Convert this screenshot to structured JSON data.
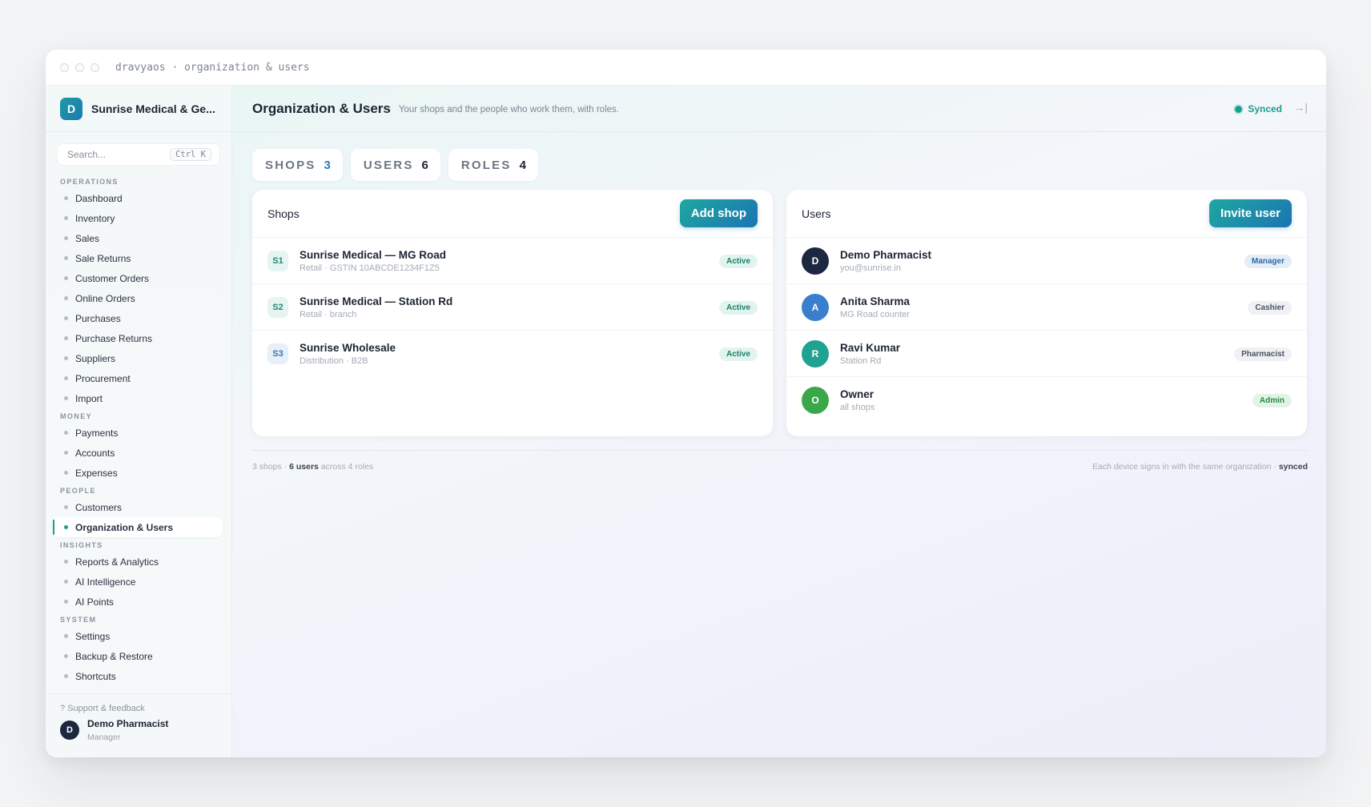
{
  "window": {
    "title": "dravyaos · organization & users"
  },
  "sidebar": {
    "org_initial": "D",
    "org_name": "Sunrise Medical & Ge...",
    "search_placeholder": "Search...",
    "search_shortcut": "Ctrl K",
    "sections": [
      {
        "title": "OPERATIONS",
        "items": [
          "Dashboard",
          "Inventory",
          "Sales",
          "Sale Returns",
          "Customer Orders",
          "Online Orders",
          "Purchases",
          "Purchase Returns",
          "Suppliers",
          "Procurement",
          "Import"
        ]
      },
      {
        "title": "MONEY",
        "items": [
          "Payments",
          "Accounts",
          "Expenses"
        ]
      },
      {
        "title": "PEOPLE",
        "items": [
          "Customers",
          "Organization & Users"
        ]
      },
      {
        "title": "INSIGHTS",
        "items": [
          "Reports & Analytics",
          "AI Intelligence",
          "AI Points"
        ]
      },
      {
        "title": "SYSTEM",
        "items": [
          "Settings",
          "Backup & Restore",
          "Shortcuts"
        ]
      }
    ],
    "active_item": "Organization & Users",
    "support": "? Support & feedback",
    "user": {
      "initial": "D",
      "name": "Demo Pharmacist",
      "role": "Manager"
    }
  },
  "header": {
    "title": "Organization & Users",
    "subtitle": "Your shops and the people who work them, with roles.",
    "sync_status": "Synced",
    "exit_icon": "→|"
  },
  "tabs": [
    {
      "label": "SHOPS",
      "count": "3"
    },
    {
      "label": "USERS",
      "count": "6"
    },
    {
      "label": "ROLES",
      "count": "4"
    }
  ],
  "shops": {
    "title": "Shops",
    "add_label": "Add shop",
    "rows": [
      {
        "code": "S1",
        "name": "Sunrise Medical — MG Road",
        "sub": "Retail · GSTIN 10ABCDE1234F1Z5",
        "status": "Active"
      },
      {
        "code": "S2",
        "name": "Sunrise Medical — Station Rd",
        "sub": "Retail · branch",
        "status": "Active"
      },
      {
        "code": "S3",
        "name": "Sunrise Wholesale",
        "sub": "Distribution · B2B",
        "status": "Active"
      }
    ]
  },
  "users": {
    "title": "Users",
    "invite_label": "Invite user",
    "rows": [
      {
        "initial": "D",
        "name": "Demo Pharmacist",
        "sub": "you@sunrise.in",
        "role": "Manager",
        "color": "#1c2740"
      },
      {
        "initial": "A",
        "name": "Anita Sharma",
        "sub": "MG Road counter",
        "role": "Cashier",
        "color": "#3a7fce"
      },
      {
        "initial": "R",
        "name": "Ravi Kumar",
        "sub": "Station Rd",
        "role": "Pharmacist",
        "color": "#1fa28f"
      },
      {
        "initial": "O",
        "name": "Owner",
        "sub": "all shops",
        "role": "Admin",
        "color": "#3aa84a"
      }
    ]
  },
  "footer": {
    "left_a": "3 shops · ",
    "left_b": "6 users",
    "left_c": " across 4 roles",
    "right_a": "Each device signs in with the same organization · ",
    "right_b": "synced"
  },
  "colors": {
    "accent": "#17a08e",
    "brand_blue": "#1c75b2"
  }
}
